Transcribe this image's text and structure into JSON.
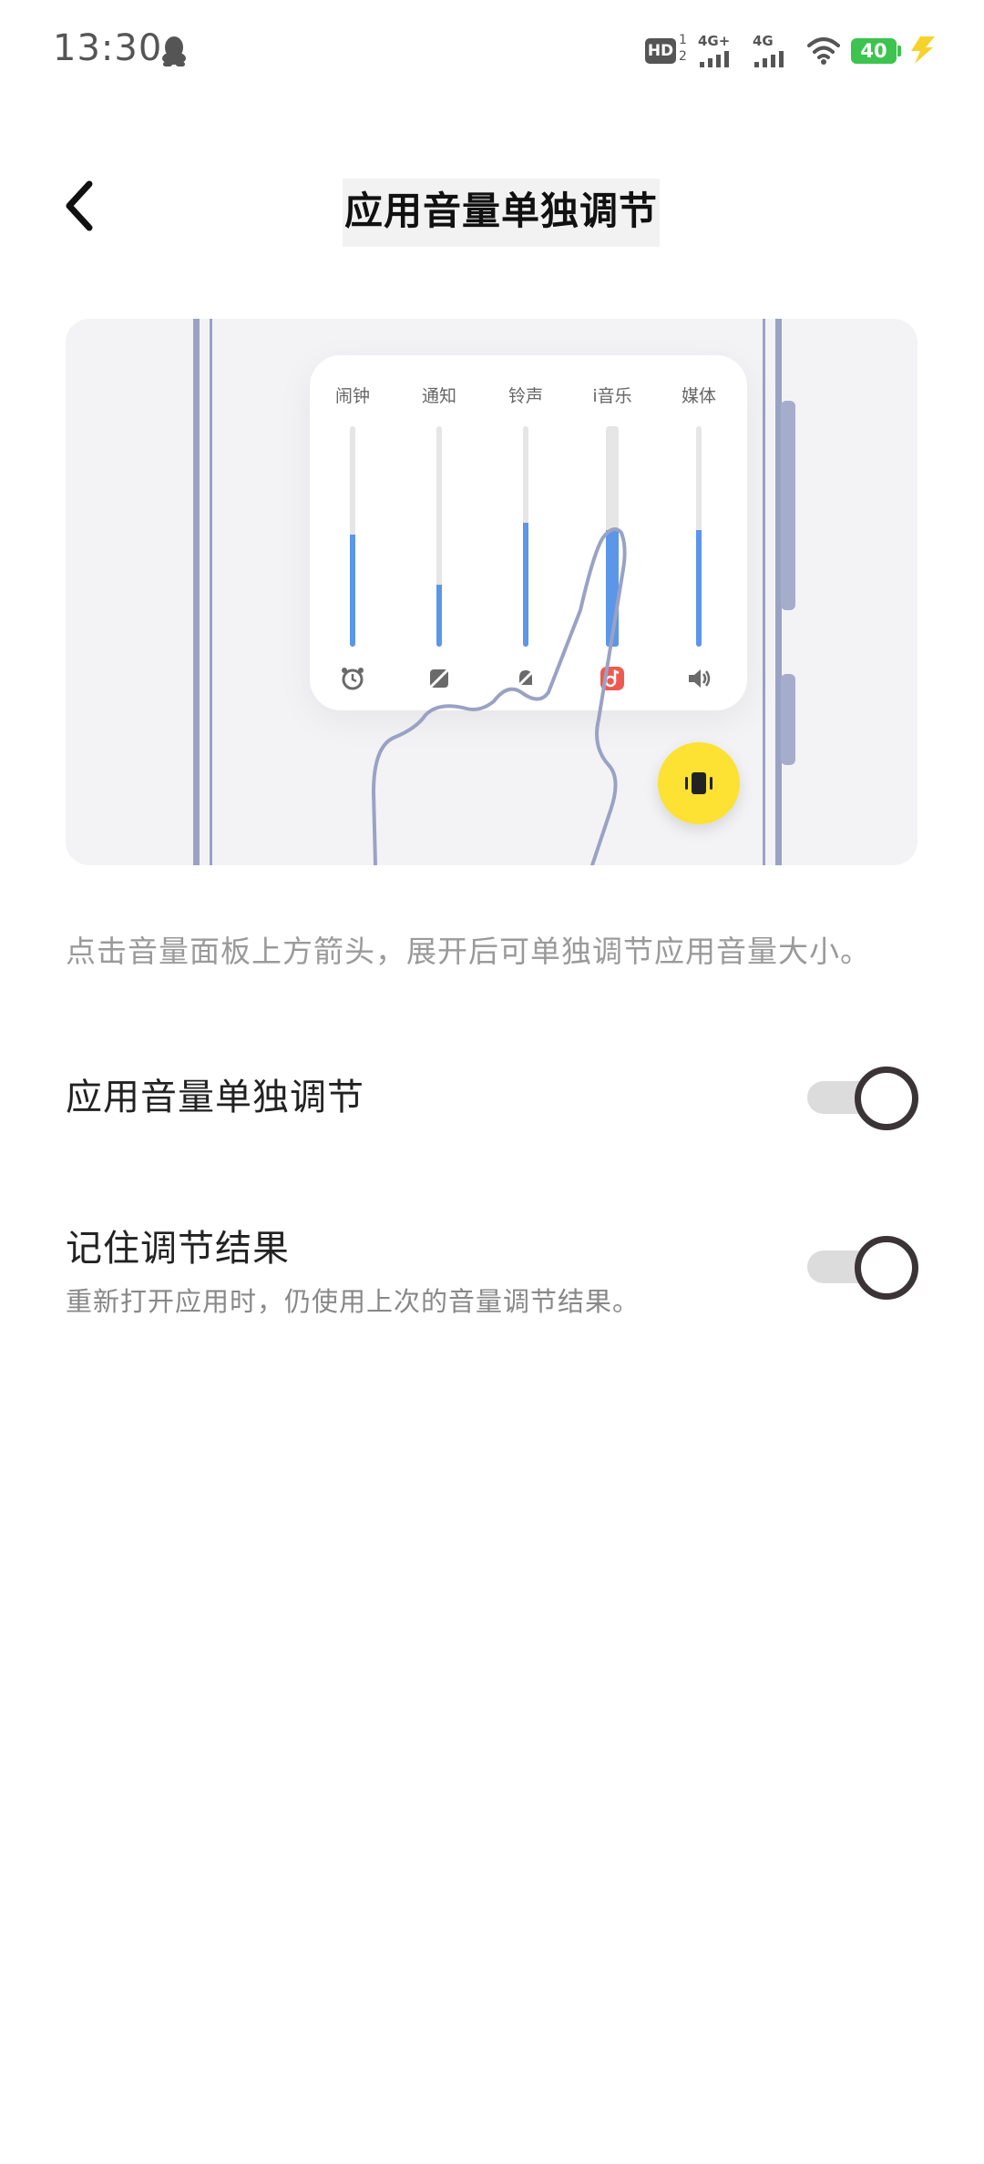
{
  "status_bar": {
    "time": "13:30",
    "battery_level": "40",
    "network_1": "4G+",
    "network_2": "4G",
    "hd_badge": "HD",
    "sim_indicator_top": "1",
    "sim_indicator_bottom": "2",
    "icons": [
      "qq-icon",
      "hd-volte-icon",
      "signal-4g-plus-icon",
      "signal-4g-icon",
      "wifi-icon",
      "battery-icon",
      "charging-bolt-icon"
    ],
    "battery_color": "#3cc44f",
    "bolt_color": "#f6d32a"
  },
  "header": {
    "title": "应用音量单独调节",
    "back_icon": "chevron-left-icon"
  },
  "illustration": {
    "channels": [
      {
        "label": "闹钟",
        "level": 0.51,
        "icon": "alarm-clock-icon"
      },
      {
        "label": "通知",
        "level": 0.28,
        "icon": "notification-muted-icon"
      },
      {
        "label": "铃声",
        "level": 0.56,
        "icon": "bell-muted-icon"
      },
      {
        "label": "i音乐",
        "level": 0.53,
        "icon": "music-app-icon"
      },
      {
        "label": "媒体",
        "level": 0.53,
        "icon": "speaker-icon"
      }
    ],
    "accent_color": "#5b96e8",
    "music_app_color": "#ee5a4f",
    "vibrate_button_icon": "vibrate-icon",
    "vibrate_button_color": "#fde133",
    "hand_icon": "pointing-hand-icon"
  },
  "description": "点击音量面板上方箭头，展开后可单独调节应用音量大小。",
  "settings": [
    {
      "title": "应用音量单独调节",
      "subtitle": "",
      "enabled": true
    },
    {
      "title": "记住调节结果",
      "subtitle": "重新打开应用时，仍使用上次的音量调节结果。",
      "enabled": true
    }
  ]
}
